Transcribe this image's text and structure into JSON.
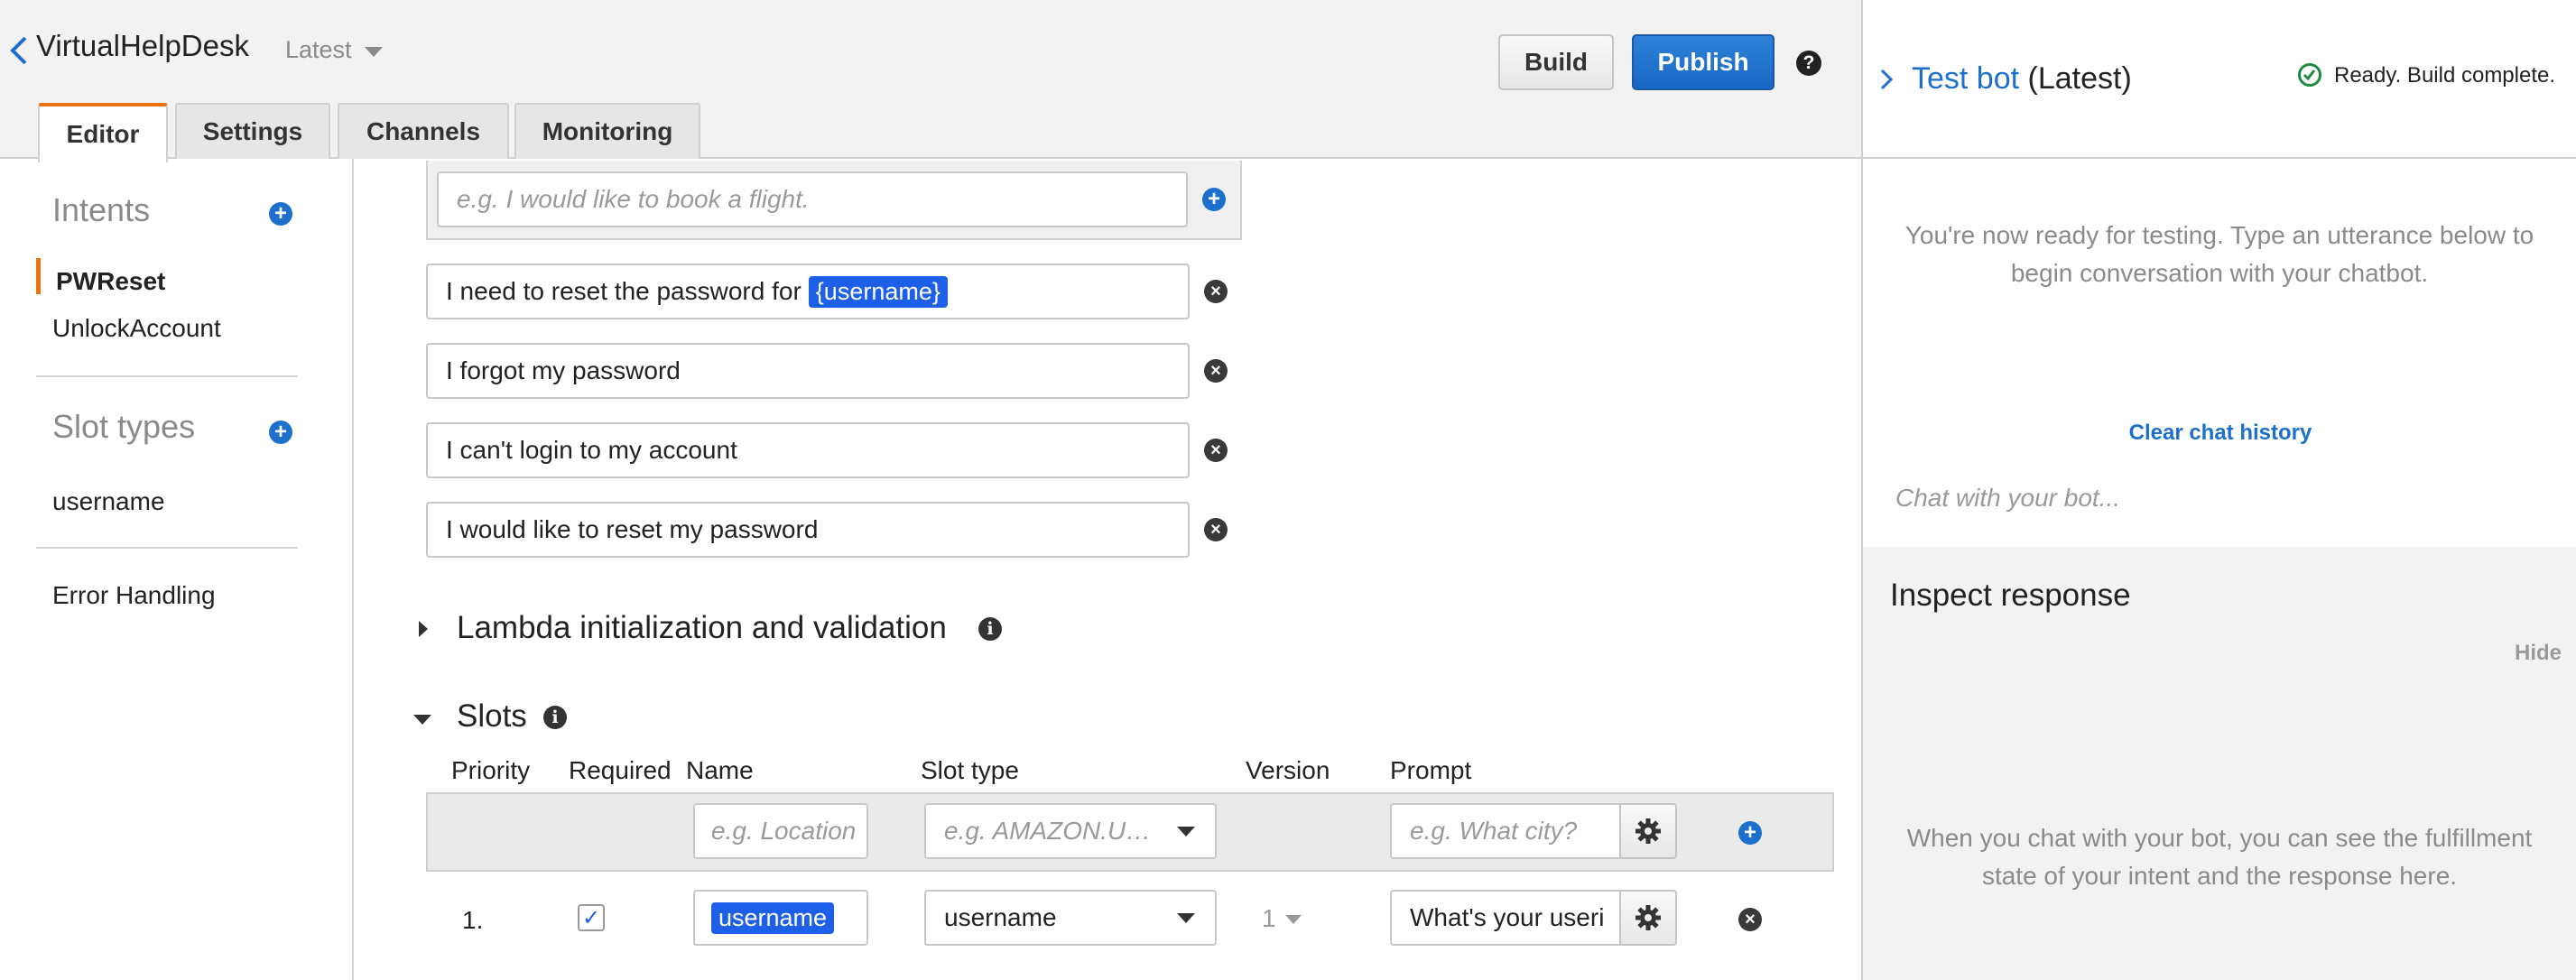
{
  "header": {
    "bot_name": "VirtualHelpDesk",
    "version": "Latest",
    "build_label": "Build",
    "publish_label": "Publish",
    "help_label": "?"
  },
  "tabs": [
    {
      "label": "Editor",
      "active": true
    },
    {
      "label": "Settings",
      "active": false
    },
    {
      "label": "Channels",
      "active": false
    },
    {
      "label": "Monitoring",
      "active": false
    }
  ],
  "sidebar": {
    "intents_heading": "Intents",
    "intents": [
      {
        "label": "PWReset",
        "selected": true
      },
      {
        "label": "UnlockAccount",
        "selected": false
      }
    ],
    "slot_types_heading": "Slot types",
    "slot_types": [
      {
        "label": "username"
      }
    ],
    "error_handling": "Error Handling"
  },
  "utterances": {
    "new_placeholder": "e.g. I would like to book a flight.",
    "items": [
      {
        "text": "I need to reset the password for",
        "slot": "{username}"
      },
      {
        "text": "I forgot my password"
      },
      {
        "text": "I can't login to my account"
      },
      {
        "text": "I would like to reset my password"
      }
    ]
  },
  "sections": {
    "lambda_title": "Lambda initialization and validation",
    "slots_title": "Slots"
  },
  "slots_table": {
    "headers": {
      "priority": "Priority",
      "required": "Required",
      "name": "Name",
      "slot_type": "Slot type",
      "version": "Version",
      "prompt": "Prompt"
    },
    "new_row": {
      "name_placeholder": "e.g. Location",
      "type_placeholder": "e.g. AMAZON.U…",
      "prompt_placeholder": "e.g. What city?"
    },
    "rows": [
      {
        "priority": "1.",
        "required": true,
        "name": "username",
        "slot_type": "username",
        "version": "1",
        "prompt": "What's your useri"
      }
    ]
  },
  "test_bot": {
    "title_link": "Test bot",
    "title_suffix": "(Latest)",
    "status": "Ready. Build complete.",
    "ready_message": "You're now ready for testing. Type an utterance below to begin conversation with your chatbot.",
    "clear_history": "Clear chat history",
    "chat_placeholder": "Chat with your bot...",
    "inspect_title": "Inspect response",
    "hide_label": "Hide",
    "inspect_message": "When you chat with your bot, you can see the fulfillment state of your intent and the response here."
  },
  "colors": {
    "accent_orange": "#ec7211",
    "link_blue": "#1d6fcc",
    "publish_blue": "#1768c4",
    "slot_chip_blue": "#1d5fe6",
    "status_green": "#1d8a3d"
  }
}
